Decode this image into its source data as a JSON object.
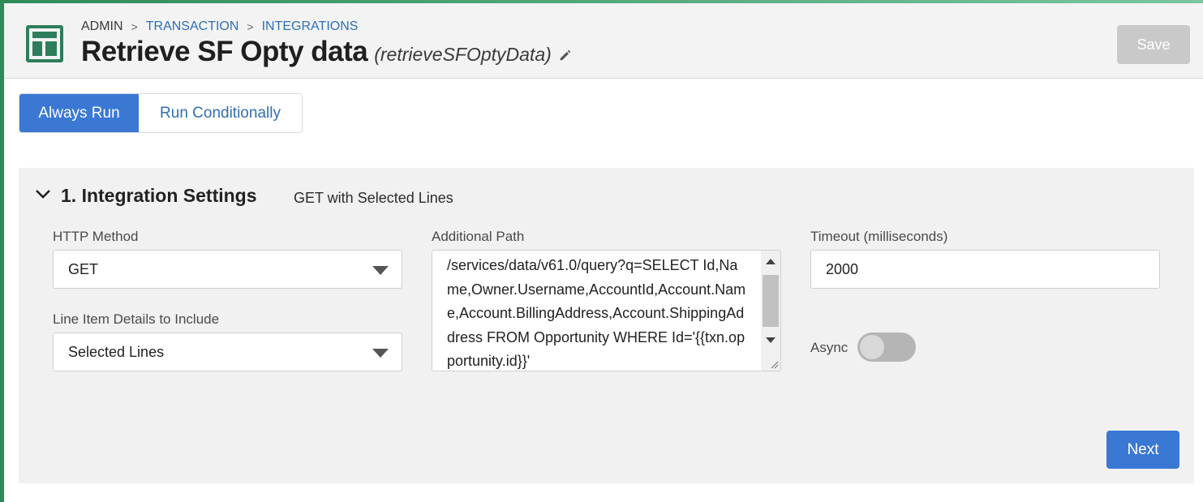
{
  "breadcrumb": {
    "items": [
      "ADMIN",
      "TRANSACTION",
      "INTEGRATIONS"
    ],
    "separator": ">"
  },
  "header": {
    "title": "Retrieve SF Opty data",
    "api_name": "(retrieveSFOptyData)",
    "save_label": "Save",
    "icon": "layout-template-icon",
    "accent_color": "#2e7d5b"
  },
  "run_mode": {
    "options": [
      "Always Run",
      "Run Conditionally"
    ],
    "selected": "Always Run"
  },
  "section": {
    "number_title": "1. Integration Settings",
    "summary": "GET with Selected Lines",
    "expanded": true
  },
  "form": {
    "http_method": {
      "label": "HTTP Method",
      "value": "GET"
    },
    "line_items": {
      "label": "Line Item Details to Include",
      "value": "Selected Lines"
    },
    "additional_path": {
      "label": "Additional Path",
      "value": "/services/data/v61.0/query?q=SELECT Id,Name,Owner.Username,AccountId,Account.Name,Account.BillingAddress,Account.ShippingAddress FROM Opportunity WHERE Id='{{txn.opportunity.id}}'"
    },
    "timeout": {
      "label": "Timeout (milliseconds)",
      "value": "2000"
    },
    "async": {
      "label": "Async",
      "enabled": false
    }
  },
  "actions": {
    "next_label": "Next"
  },
  "colors": {
    "primary": "#3a78d4",
    "disabled": "#c9c9c9",
    "link": "#2f6fb5"
  }
}
